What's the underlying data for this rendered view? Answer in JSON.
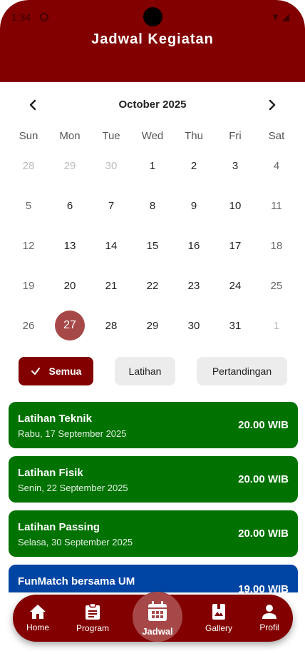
{
  "status": {
    "time": "1:34"
  },
  "header": {
    "title": "Jadwal Kegiatan"
  },
  "calendar": {
    "month_label": "October 2025",
    "weekdays": [
      "Sun",
      "Mon",
      "Tue",
      "Wed",
      "Thu",
      "Fri",
      "Sat"
    ],
    "weeks": [
      [
        "28",
        "29",
        "30",
        "1",
        "2",
        "3",
        "4"
      ],
      [
        "5",
        "6",
        "7",
        "8",
        "9",
        "10",
        "11"
      ],
      [
        "12",
        "13",
        "14",
        "15",
        "16",
        "17",
        "18"
      ],
      [
        "19",
        "20",
        "21",
        "22",
        "23",
        "24",
        "25"
      ],
      [
        "26",
        "27",
        "28",
        "29",
        "30",
        "31",
        "1"
      ]
    ],
    "selected_day": "27"
  },
  "filters": {
    "all": "Semua",
    "training": "Latihan",
    "match": "Pertandingan"
  },
  "events": [
    {
      "title": "Latihan Teknik",
      "date": "Rabu, 17 September 2025",
      "time": "20.00 WIB",
      "color": "#007200"
    },
    {
      "title": "Latihan Fisik",
      "date": "Senin, 22 September 2025",
      "time": "20.00 WIB",
      "color": "#007200"
    },
    {
      "title": "Latihan Passing",
      "date": "Selasa, 30 September 2025",
      "time": "20.00 WIB",
      "color": "#007200"
    },
    {
      "title": "FunMatch bersama UM",
      "date": "",
      "time": "19.00 WIB",
      "color": "#0045a3"
    }
  ],
  "nav": {
    "home": "Home",
    "program": "Program",
    "jadwal": "Jadwal",
    "gallery": "Gallery",
    "profil": "Profil"
  },
  "colors": {
    "brand": "#820000",
    "selected": "#a74848",
    "training": "#007200",
    "match": "#0045a3"
  }
}
